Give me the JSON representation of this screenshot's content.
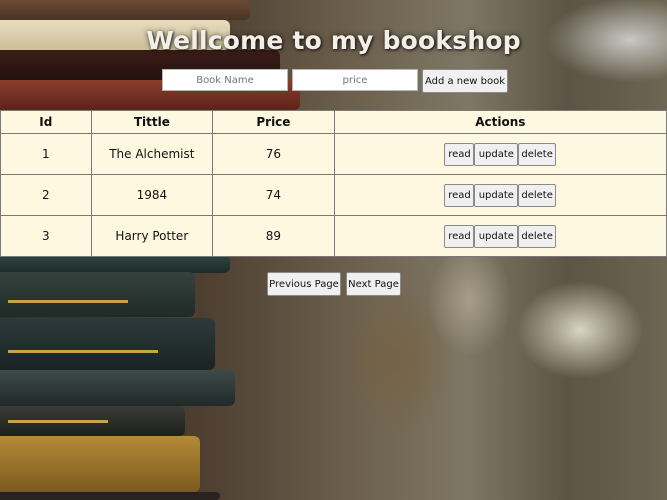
{
  "header": {
    "title": "Wellcome to my bookshop"
  },
  "form": {
    "name_placeholder": "Book Name",
    "price_placeholder": "price",
    "add_label": "Add a new book"
  },
  "table": {
    "headers": [
      "Id",
      "Tittle",
      "Price",
      "Actions"
    ],
    "rows": [
      {
        "id": "1",
        "title": "The Alchemist",
        "price": "76"
      },
      {
        "id": "2",
        "title": "1984",
        "price": "74"
      },
      {
        "id": "3",
        "title": "Harry Potter",
        "price": "89"
      }
    ],
    "actions": {
      "read": "read",
      "update": "update",
      "delete": "delete"
    }
  },
  "pager": {
    "prev_label": "Previous Page",
    "next_label": "Next Page"
  },
  "colors": {
    "table_bg": "#fff8e1",
    "title_text": "#f3efe8"
  }
}
